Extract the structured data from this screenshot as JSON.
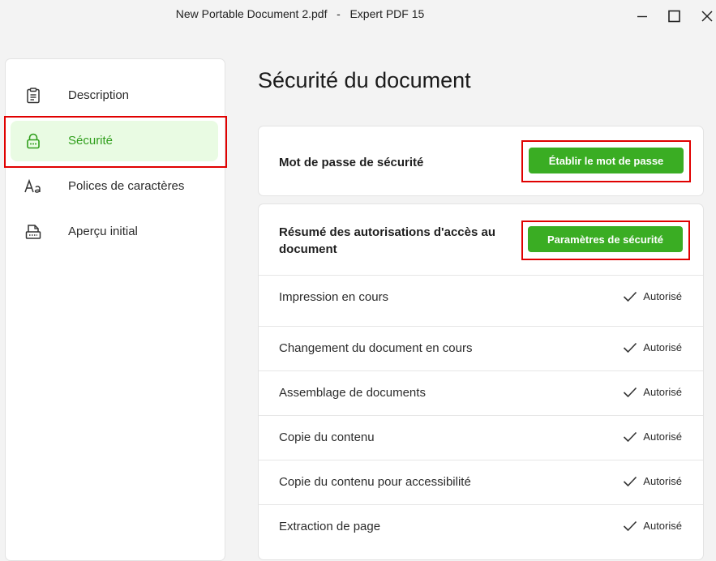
{
  "window": {
    "title": "New Portable Document 2.pdf   -   Expert PDF 15",
    "controls": [
      "minimize-icon",
      "maximize-icon",
      "close-icon"
    ]
  },
  "sidebar": {
    "items": [
      {
        "label": "Description",
        "icon": "clipboard-icon",
        "active": false
      },
      {
        "label": "Sécurité",
        "icon": "lock-icon",
        "active": true
      },
      {
        "label": "Polices de caractères",
        "icon": "font-icon",
        "active": false
      },
      {
        "label": "Aperçu initial",
        "icon": "page-view-icon",
        "active": false
      }
    ]
  },
  "main": {
    "title": "Sécurité du document",
    "password_card": {
      "heading": "Mot de passe de sécurité",
      "button_label": "Établir le mot de passe"
    },
    "permissions_card": {
      "heading_line1": "Résumé des autorisations d'accès au",
      "heading_line2": "document",
      "button_label": "Paramètres de sécurité",
      "rows": [
        {
          "label": "Impression en cours",
          "status": "Autorisé"
        },
        {
          "label": "Changement du document en cours",
          "status": "Autorisé"
        },
        {
          "label": "Assemblage de documents",
          "status": "Autorisé"
        },
        {
          "label": "Copie du contenu",
          "status": "Autorisé"
        },
        {
          "label": "Copie du contenu pour accessibilité",
          "status": "Autorisé"
        },
        {
          "label": "Extraction de page",
          "status": "Autorisé"
        }
      ]
    }
  },
  "colors": {
    "accent_green": "#3aad23",
    "active_bg": "#e9fbe3",
    "active_text": "#2f9e1b",
    "highlight_red": "#e00000"
  }
}
